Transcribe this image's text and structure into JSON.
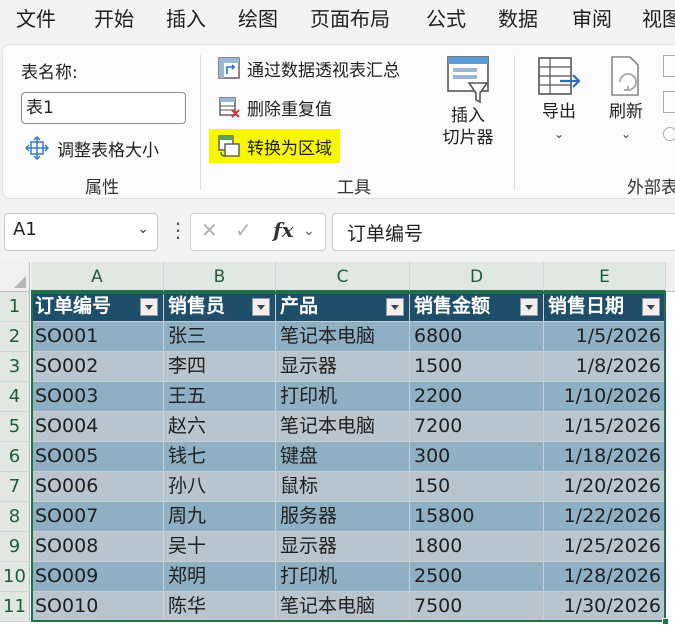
{
  "menu_tabs": [
    "文件",
    "开始",
    "插入",
    "绘图",
    "页面布局",
    "公式",
    "数据",
    "审阅",
    "视图"
  ],
  "ribbon": {
    "properties": {
      "table_name_label": "表名称:",
      "table_name_value": "表1",
      "resize_label": "调整表格大小",
      "group_label": "属性"
    },
    "tools": {
      "pivot_label": "通过数据透视表汇总",
      "remove_dup_label": "删除重复值",
      "convert_label": "转换为区域",
      "slicer_label_1": "插入",
      "slicer_label_2": "切片器",
      "group_label": "工具"
    },
    "external": {
      "export_label": "导出",
      "refresh_label": "刷新",
      "group_label": "外部表"
    },
    "highlight_color": "#f7f700"
  },
  "formula_bar": {
    "name_box": "A1",
    "fx_label": "fx",
    "formula_value": "订单编号"
  },
  "sheet": {
    "columns": [
      "A",
      "B",
      "C",
      "D",
      "E"
    ],
    "row_numbers": [
      "1",
      "2",
      "3",
      "4",
      "5",
      "6",
      "7",
      "8",
      "9",
      "10",
      "11"
    ],
    "headers": [
      "订单编号",
      "销售员",
      "产品",
      "销售金额",
      "销售日期"
    ],
    "rows": [
      [
        "SO001",
        "张三",
        "笔记本电脑",
        "6800",
        "1/5/2026"
      ],
      [
        "SO002",
        "李四",
        "显示器",
        "1500",
        "1/8/2026"
      ],
      [
        "SO003",
        "王五",
        "打印机",
        "2200",
        "1/10/2026"
      ],
      [
        "SO004",
        "赵六",
        "笔记本电脑",
        "7200",
        "1/15/2026"
      ],
      [
        "SO005",
        "钱七",
        "键盘",
        "300",
        "1/18/2026"
      ],
      [
        "SO006",
        "孙八",
        "鼠标",
        "150",
        "1/20/2026"
      ],
      [
        "SO007",
        "周九",
        "服务器",
        "15800",
        "1/22/2026"
      ],
      [
        "SO008",
        "吴十",
        "显示器",
        "1800",
        "1/25/2026"
      ],
      [
        "SO009",
        "郑明",
        "打印机",
        "2500",
        "1/28/2026"
      ],
      [
        "SO010",
        "陈华",
        "笔记本电脑",
        "7500",
        "1/30/2026"
      ]
    ],
    "header_color": "#1f4e6a",
    "band_colors": [
      "#8fb0c4",
      "#b8c5ce"
    ],
    "selection_color": "#1e7145"
  }
}
